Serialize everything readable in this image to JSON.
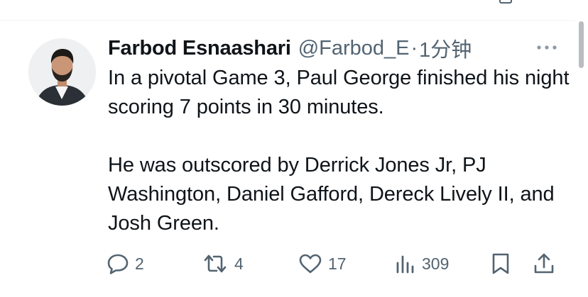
{
  "tweet": {
    "author_name": "Farbod Esnaashari",
    "handle": "@Farbod_E",
    "separator": "·",
    "time": "1分钟",
    "text": "In a pivotal Game 3, Paul George finished his night scoring 7 points in 30 minutes.\n\nHe was outscored by Derrick Jones Jr, PJ Washington, Daniel Gafford, Dereck Lively II, and Josh Green."
  },
  "actions": {
    "reply_count": "2",
    "retweet_count": "4",
    "like_count": "17",
    "views_count": "309"
  },
  "icons": {
    "more": "more-horizontal-icon",
    "reply": "speech-bubble-icon",
    "retweet": "retweet-arrows-icon",
    "like": "heart-icon",
    "views": "bar-chart-icon",
    "bookmark": "bookmark-icon",
    "share": "share-upload-icon"
  },
  "colors": {
    "text": "#0f1419",
    "secondary": "#536471",
    "divider": "#eff3f4"
  }
}
